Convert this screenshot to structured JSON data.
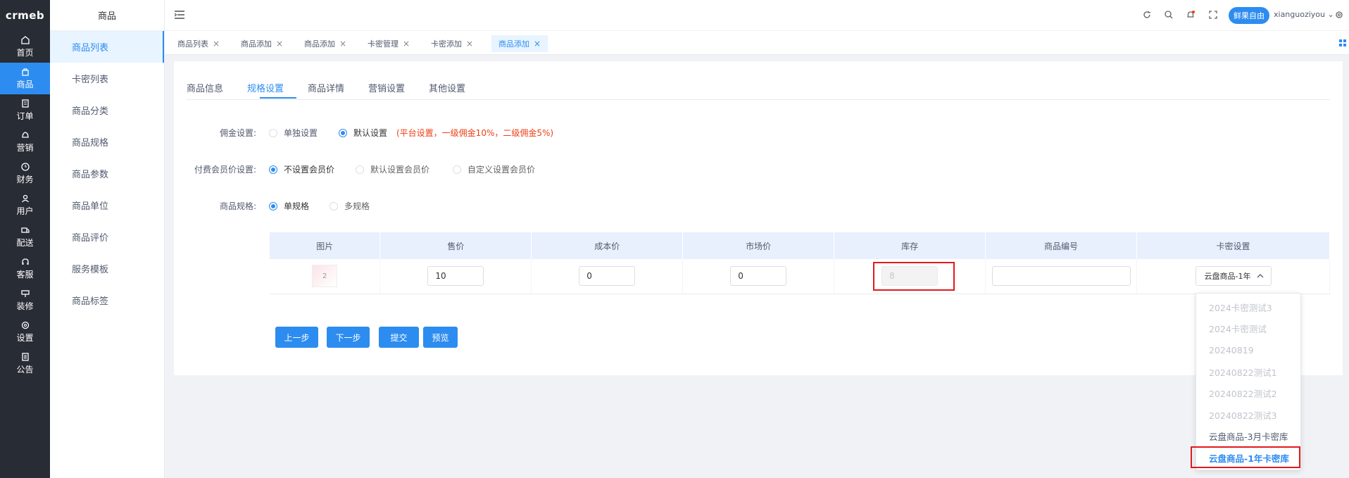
{
  "rail": {
    "logo": "crmeb",
    "items": [
      {
        "label": "首页",
        "icon": "home-icon"
      },
      {
        "label": "商品",
        "icon": "goods-icon",
        "active": true
      },
      {
        "label": "订单",
        "icon": "order-icon"
      },
      {
        "label": "营销",
        "icon": "marketing-icon"
      },
      {
        "label": "财务",
        "icon": "finance-icon"
      },
      {
        "label": "用户",
        "icon": "user-icon"
      },
      {
        "label": "配送",
        "icon": "delivery-icon"
      },
      {
        "label": "客服",
        "icon": "headset-icon"
      },
      {
        "label": "装修",
        "icon": "decorate-icon"
      },
      {
        "label": "设置",
        "icon": "settings-icon"
      },
      {
        "label": "公告",
        "icon": "notice-icon"
      }
    ]
  },
  "submenu": {
    "title": "商品",
    "items": [
      {
        "label": "商品列表",
        "active": true
      },
      {
        "label": "卡密列表"
      },
      {
        "label": "商品分类"
      },
      {
        "label": "商品规格"
      },
      {
        "label": "商品参数"
      },
      {
        "label": "商品单位"
      },
      {
        "label": "商品评价"
      },
      {
        "label": "服务模板"
      },
      {
        "label": "商品标签"
      }
    ]
  },
  "header": {
    "user_button": "鲜果自由",
    "username": "xianguoziyou"
  },
  "tabs": [
    {
      "label": "商品列表"
    },
    {
      "label": "商品添加"
    },
    {
      "label": "商品添加"
    },
    {
      "label": "卡密管理"
    },
    {
      "label": "卡密添加"
    },
    {
      "label": "商品添加",
      "active": true
    }
  ],
  "content_tabs": [
    "商品信息",
    "规格设置",
    "商品详情",
    "营销设置",
    "其他设置"
  ],
  "form": {
    "commission": {
      "label": "佣金设置:",
      "options": [
        "单独设置",
        "默认设置"
      ],
      "selected": "默认设置",
      "note": "(平台设置，一级佣金10%，二级佣金5%)"
    },
    "member_price": {
      "label": "付费会员价设置:",
      "options": [
        "不设置会员价",
        "默认设置会员价",
        "自定义设置会员价"
      ],
      "selected": "不设置会员价"
    },
    "spec": {
      "label": "商品规格:",
      "options": [
        "单规格",
        "多规格"
      ],
      "selected": "单规格"
    }
  },
  "table": {
    "headers": [
      "图片",
      "售价",
      "成本价",
      "市场价",
      "库存",
      "商品编号",
      "卡密设置"
    ],
    "row": {
      "thumb_text": "2",
      "price": "10",
      "cost": "0",
      "market": "0",
      "stock": "8",
      "code": "",
      "card_select": "云盘商品-1年"
    }
  },
  "buttons": [
    "上一步",
    "下一步",
    "提交",
    "预览"
  ],
  "dropdown": {
    "options": [
      {
        "label": "2024卡密测试3",
        "state": "disabled"
      },
      {
        "label": "2024卡密测试",
        "state": "disabled"
      },
      {
        "label": "20240819",
        "state": "disabled"
      },
      {
        "label": "20240822测试1",
        "state": "disabled"
      },
      {
        "label": "20240822测试2",
        "state": "disabled"
      },
      {
        "label": "20240822测试3",
        "state": "disabled"
      },
      {
        "label": "云盘商品-3月卡密库",
        "state": "normal"
      },
      {
        "label": "云盘商品-1年卡密库",
        "state": "selected"
      }
    ]
  },
  "colors": {
    "primary": "#2d8cf0",
    "rail_bg": "#282c34",
    "highlight_red": "#e2191c",
    "note_red": "#ed4014"
  }
}
